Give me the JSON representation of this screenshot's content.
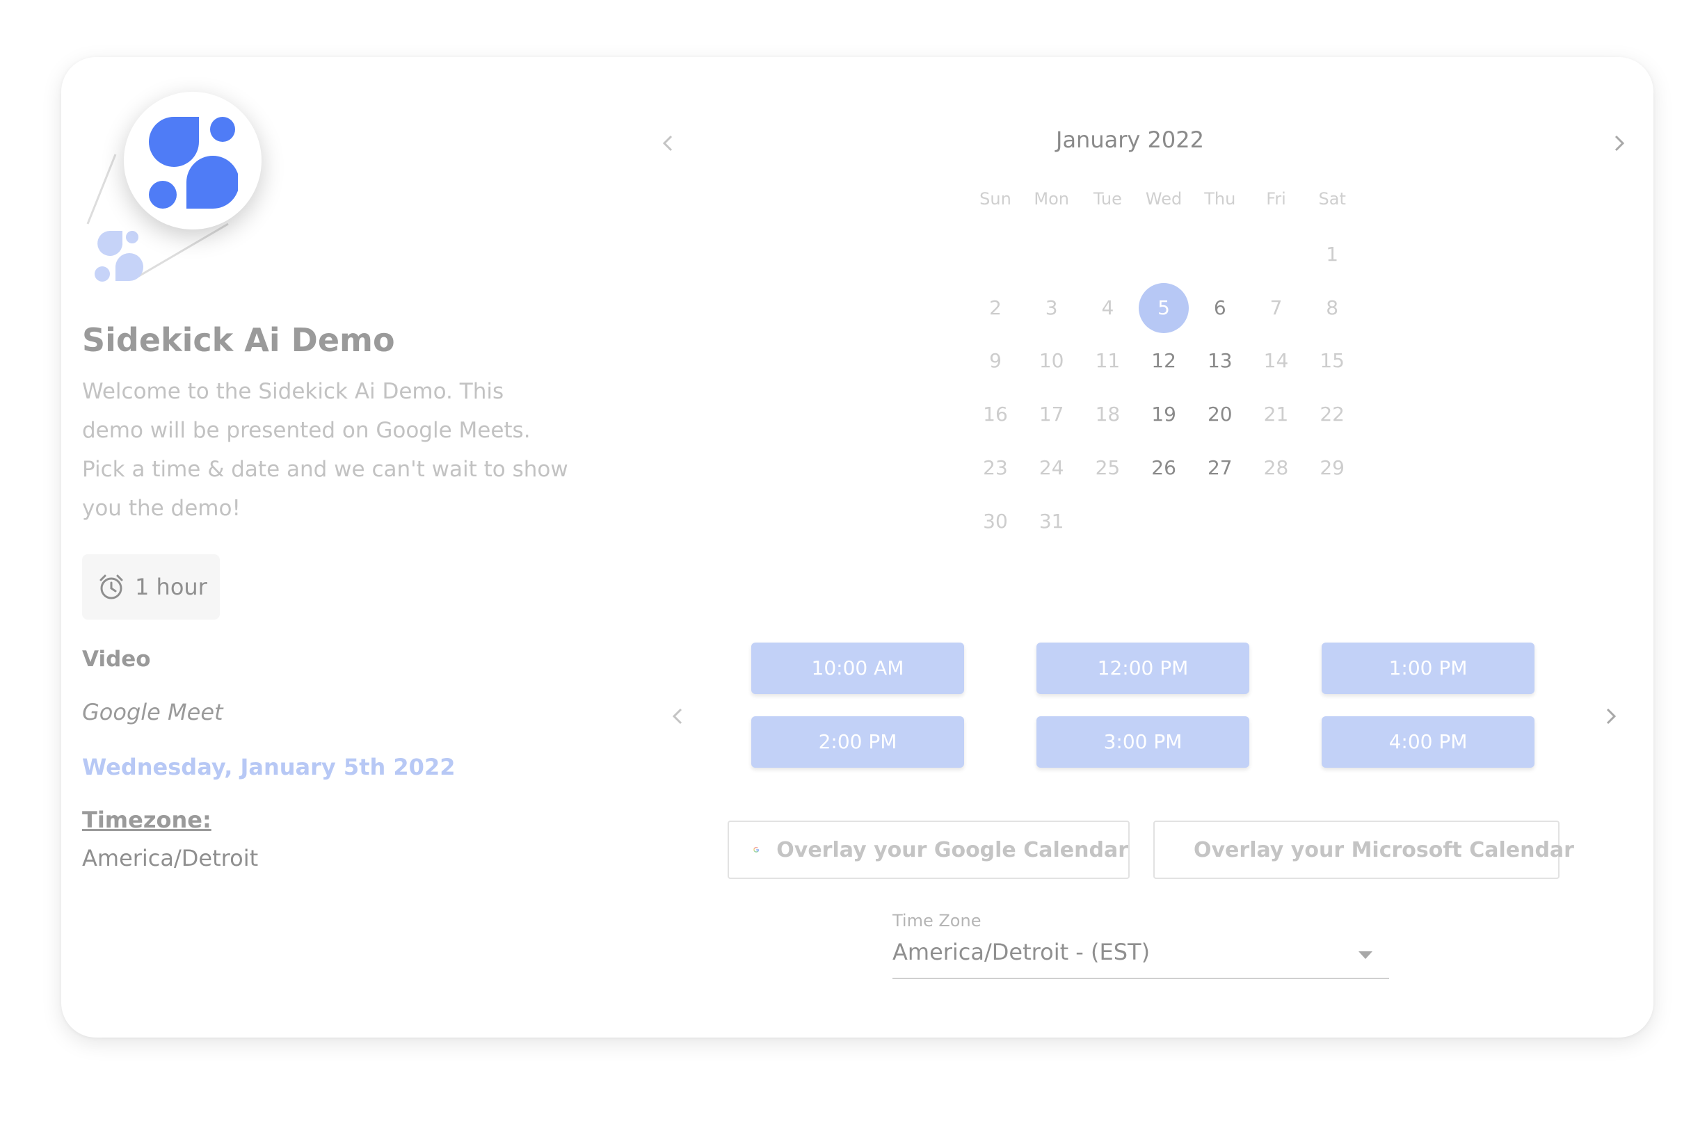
{
  "event": {
    "title": "Sidekick Ai Demo",
    "description": "Welcome to the Sidekick Ai Demo. This demo will be presented on Google Meets. Pick a time & date and we can't wait to show you the demo!",
    "duration": "1 hour",
    "location_heading": "Video",
    "location_value": "Google Meet",
    "selected_date": "Wednesday, January 5th 2022",
    "timezone_heading": "Timezone:",
    "timezone_value": "America/Detroit"
  },
  "calendar": {
    "month_label": "January 2022",
    "weekdays": [
      "Sun",
      "Mon",
      "Tue",
      "Wed",
      "Thu",
      "Fri",
      "Sat"
    ],
    "days": [
      {
        "label": "1",
        "state": "unavailable"
      },
      {
        "label": "2",
        "state": "unavailable"
      },
      {
        "label": "3",
        "state": "unavailable"
      },
      {
        "label": "4",
        "state": "unavailable"
      },
      {
        "label": "5",
        "state": "selected"
      },
      {
        "label": "6",
        "state": "available"
      },
      {
        "label": "7",
        "state": "unavailable"
      },
      {
        "label": "8",
        "state": "unavailable"
      },
      {
        "label": "9",
        "state": "unavailable"
      },
      {
        "label": "10",
        "state": "unavailable"
      },
      {
        "label": "11",
        "state": "unavailable"
      },
      {
        "label": "12",
        "state": "available"
      },
      {
        "label": "13",
        "state": "available"
      },
      {
        "label": "14",
        "state": "unavailable"
      },
      {
        "label": "15",
        "state": "unavailable"
      },
      {
        "label": "16",
        "state": "unavailable"
      },
      {
        "label": "17",
        "state": "unavailable"
      },
      {
        "label": "18",
        "state": "unavailable"
      },
      {
        "label": "19",
        "state": "available"
      },
      {
        "label": "20",
        "state": "available"
      },
      {
        "label": "21",
        "state": "unavailable"
      },
      {
        "label": "22",
        "state": "unavailable"
      },
      {
        "label": "23",
        "state": "unavailable"
      },
      {
        "label": "24",
        "state": "unavailable"
      },
      {
        "label": "25",
        "state": "unavailable"
      },
      {
        "label": "26",
        "state": "available"
      },
      {
        "label": "27",
        "state": "available"
      },
      {
        "label": "28",
        "state": "unavailable"
      },
      {
        "label": "29",
        "state": "unavailable"
      },
      {
        "label": "30",
        "state": "unavailable"
      },
      {
        "label": "31",
        "state": "unavailable"
      }
    ]
  },
  "time_slots": [
    "10:00 AM",
    "12:00 PM",
    "1:00 PM",
    "2:00 PM",
    "3:00 PM",
    "4:00 PM"
  ],
  "overlay": {
    "google_label": "Overlay your Google Calendar",
    "microsoft_label": "Overlay your Microsoft Calendar"
  },
  "timezone_select": {
    "label": "Time Zone",
    "value": "America/Detroit - (EST)"
  },
  "icons": {
    "prev": "chevron-left-icon",
    "next": "chevron-right-icon",
    "duration": "alarm-clock-icon",
    "google": "google-g-icon",
    "microsoft": "microsoft-windows-icon",
    "dropdown": "caret-down-icon"
  },
  "colors": {
    "accent": "#b7c8f5",
    "slot": "#c2d1f7",
    "logo_blue": "#4f7cf6"
  }
}
